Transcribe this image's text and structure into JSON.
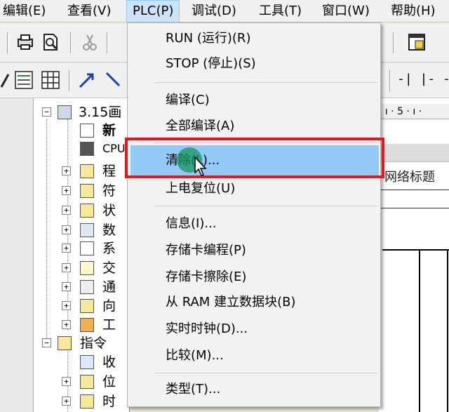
{
  "menubar": {
    "items": [
      "编辑(E)",
      "查看(V)",
      "PLC(P)",
      "调试(D)",
      "工具(T)",
      "窗口(W)",
      "帮助(H)"
    ]
  },
  "tree": {
    "project": "3.15画",
    "items": [
      "新",
      "CPU",
      "程",
      "符",
      "状",
      "数",
      "系",
      "交",
      "通",
      "向",
      "工"
    ],
    "instructions": "指令",
    "sub_items": [
      "收",
      "位",
      "时"
    ]
  },
  "editor": {
    "ruler": "· ı · 5 · ı ·",
    "network_title": "网络标题",
    "contact_glyphs": "-| |- -()"
  },
  "plc_menu": {
    "items": [
      "RUN (运行)(R)",
      "STOP (停止)(S)",
      "编译(C)",
      "全部编译(A)",
      "清除(L)...",
      "上电复位(U)",
      "信息(I)...",
      "存储卡编程(P)",
      "存储卡擦除(E)",
      "从 RAM 建立数据块(B)",
      "实时时钟(D)...",
      "比较(M)...",
      "类型(T)..."
    ],
    "highlighted_index": 4
  },
  "colors": {
    "highlight": "#91c9f7",
    "callout": "#e8141e",
    "cursor_dot": "#14965a"
  }
}
